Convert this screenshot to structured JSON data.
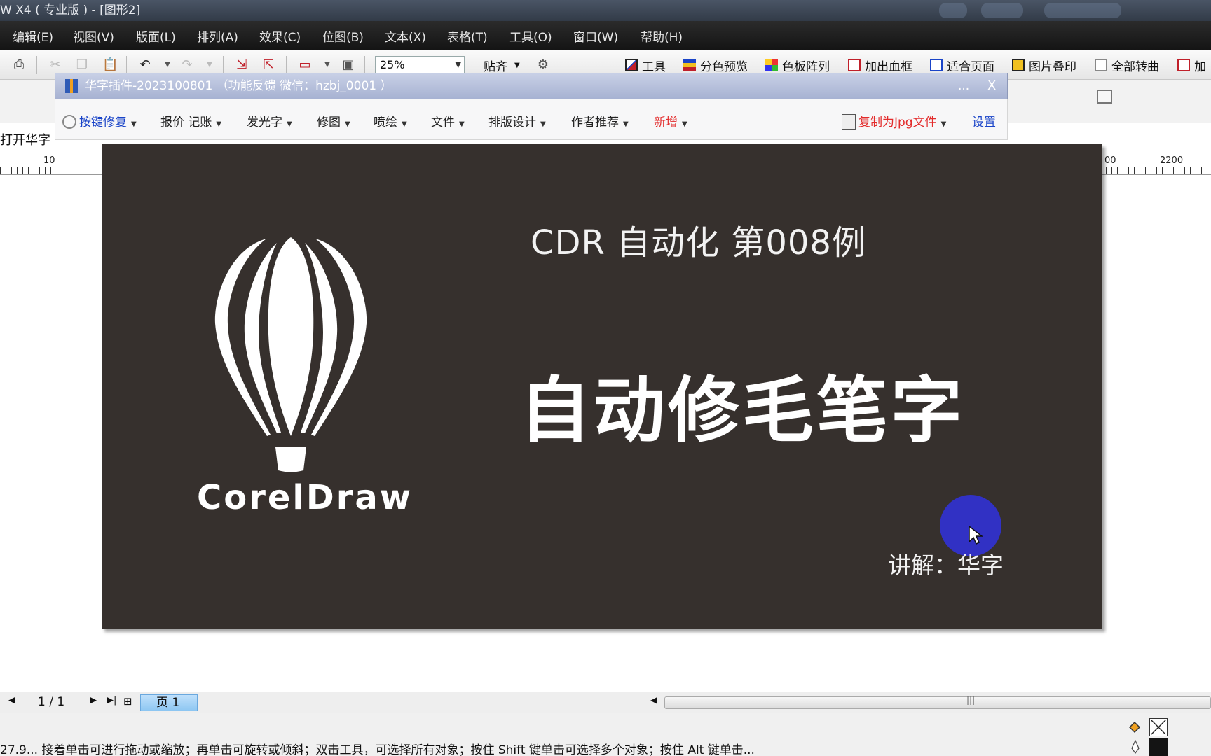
{
  "window": {
    "title": "W X4 ( 专业版 ) - [图形2]"
  },
  "menubar": {
    "items": [
      {
        "label": "编辑(E)"
      },
      {
        "label": "视图(V)"
      },
      {
        "label": "版面(L)"
      },
      {
        "label": "排列(A)"
      },
      {
        "label": "效果(C)"
      },
      {
        "label": "位图(B)"
      },
      {
        "label": "文本(X)"
      },
      {
        "label": "表格(T)"
      },
      {
        "label": "工具(O)"
      },
      {
        "label": "窗口(W)"
      },
      {
        "label": "帮助(H)"
      }
    ]
  },
  "toolbar": {
    "zoom_value": "25%",
    "snap_label": "贴齐",
    "plugin_buttons": [
      {
        "label": "工具",
        "icon": "tools-icon"
      },
      {
        "label": "分色预览",
        "icon": "separation-preview-icon"
      },
      {
        "label": "色板阵列",
        "icon": "palette-array-icon"
      },
      {
        "label": "加出血框",
        "icon": "bleed-frame-icon"
      },
      {
        "label": "适合页面",
        "icon": "fit-page-icon"
      },
      {
        "label": "图片叠印",
        "icon": "image-overprint-icon"
      },
      {
        "label": "全部转曲",
        "icon": "convert-curves-icon"
      },
      {
        "label": "加",
        "icon": "add-icon"
      }
    ]
  },
  "sidebar": {
    "open_text": "打开华字"
  },
  "ruler": {
    "left_label": "10",
    "right_label_partial": "00",
    "right_label": "2200"
  },
  "plugin": {
    "title": "华字插件-2023100801 （功能反馈 微信：hzbj_0001 ）",
    "minimize": "...",
    "close": "X",
    "menu": [
      {
        "label": "按键修复"
      },
      {
        "label": "报价 记账"
      },
      {
        "label": "发光字"
      },
      {
        "label": "修图"
      },
      {
        "label": "喷绘"
      },
      {
        "label": "文件"
      },
      {
        "label": "排版设计"
      },
      {
        "label": "作者推荐"
      },
      {
        "label": "新增"
      }
    ],
    "copy_jpg": "复制为Jpg文件",
    "settings": "设置"
  },
  "slide": {
    "subtitle": "CDR 自动化 第008例",
    "headline": "自动修毛笔字",
    "brand": "CorelDraw",
    "credit": "讲解：华字"
  },
  "pagebar": {
    "page_counter": "1 / 1",
    "page_tab": "页 1"
  },
  "statusbar": {
    "text": "27.9...  接着单击可进行拖动或缩放；再单击可旋转或倾斜；双击工具，可选择所有对象；按住 Shift 键单击可选择多个对象；按住 Alt 键单击..."
  },
  "colors": {
    "slide_bg": "#36302d",
    "menubar_bg": "#1d1d1d",
    "plugin_title_bg": "#b3bcd9",
    "accent_blue": "#1a44c8",
    "accent_red": "#e32b2b",
    "cursor_dot": "#3131c4"
  }
}
